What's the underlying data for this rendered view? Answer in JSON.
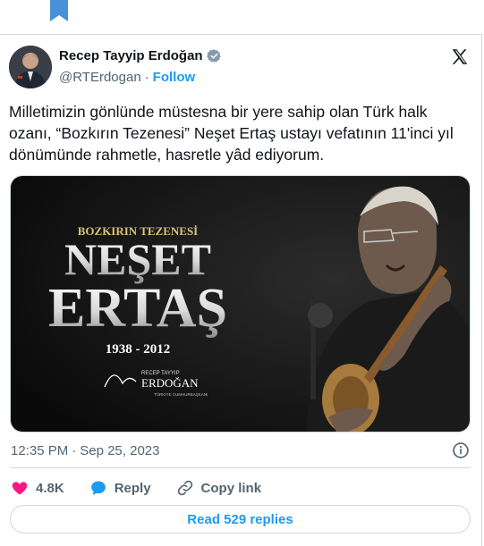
{
  "colors": {
    "accent": "#1d9bf0",
    "heart": "#f91880",
    "text": "#0f1419",
    "muted": "#536471",
    "border": "#cfd9de"
  },
  "author": {
    "name": "Recep Tayyip Erdoğan",
    "handle": "@RTErdogan",
    "separator": "·",
    "follow_label": "Follow",
    "verified_icon": "verified-badge-icon"
  },
  "tweet": {
    "text": "Milletimizin gönlünde müstesna bir yere sahip olan Türk halk ozanı, “Bozkırın Tezenesi” Neşet Ertaş ustayı vefatının 11'inci yıl dönümünde rahmetle, hasretle yâd ediyorum.",
    "time": "12:35 PM",
    "date_separator": "·",
    "date": "Sep 25, 2023"
  },
  "media": {
    "subtitle": "BOZKIRIN TEZENESİ",
    "first_name": "NEŞET",
    "last_name": "ERTAŞ",
    "years": "1938 - 2012",
    "signature_name": "RECEP TAYYIP",
    "signature_surname": "ERDOĞAN",
    "signature_title": "TÜRKİYE CUMHURBAŞKANI"
  },
  "actions": {
    "like_count": "4.8K",
    "reply_label": "Reply",
    "copy_label": "Copy link"
  },
  "read_replies_label": "Read 529 replies"
}
